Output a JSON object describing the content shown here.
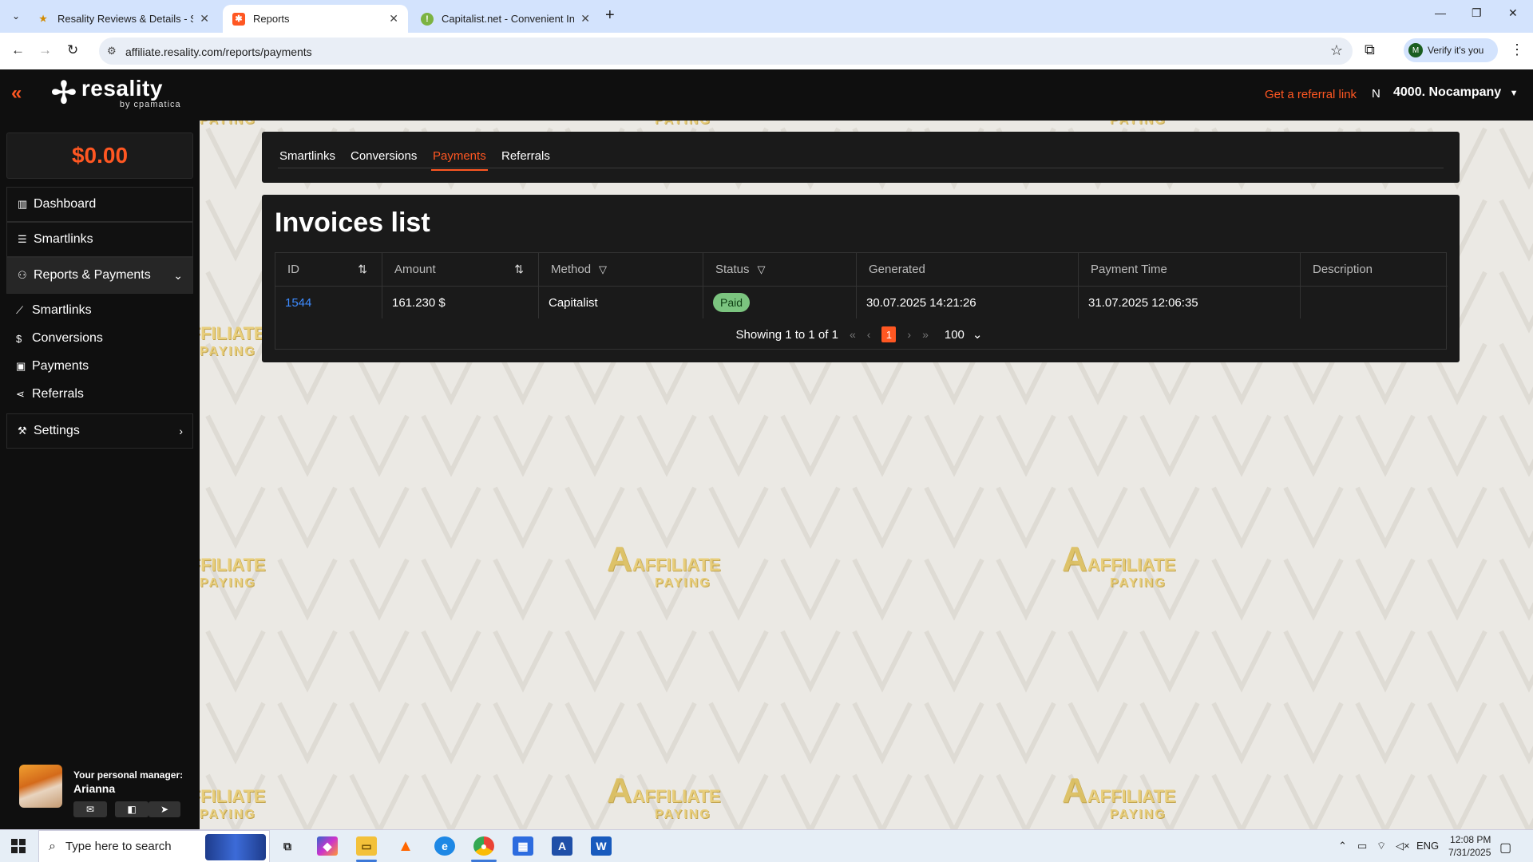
{
  "browser": {
    "tabs": [
      {
        "title": "Resality Reviews & Details - Sm",
        "active": false
      },
      {
        "title": "Reports",
        "active": true
      },
      {
        "title": "Capitalist.net - Convenient Inte",
        "active": false
      }
    ],
    "url": "affiliate.resality.com/reports/payments",
    "verify_label": "Verify it's you",
    "profile_initial": "M"
  },
  "header": {
    "logo_name": "resality",
    "logo_sub": "by cpamatica",
    "referral_link": "Get a referral link",
    "user_initial": "N",
    "account_name": "4000. Nocampany",
    "accent_color": "#ff5722"
  },
  "sidebar": {
    "balance": "$0.00",
    "items": [
      {
        "label": "Dashboard",
        "icon": "bar-chart-icon"
      },
      {
        "label": "Smartlinks",
        "icon": "list-icon"
      },
      {
        "label": "Reports & Payments",
        "icon": "users-icon",
        "expanded": true
      },
      {
        "label": "Settings",
        "icon": "wrench-icon"
      }
    ],
    "subitems": [
      {
        "label": "Smartlinks",
        "icon": "line-chart-icon"
      },
      {
        "label": "Conversions",
        "icon": "dollar-icon"
      },
      {
        "label": "Payments",
        "icon": "receipt-icon"
      },
      {
        "label": "Referrals",
        "icon": "share-icon"
      }
    ],
    "manager": {
      "label": "Your personal manager:",
      "name": "Arianna"
    }
  },
  "reports": {
    "tabs": [
      "Smartlinks",
      "Conversions",
      "Payments",
      "Referrals"
    ],
    "active_tab": "Payments"
  },
  "invoices": {
    "title": "Invoices list",
    "columns": [
      "ID",
      "Amount",
      "Method",
      "Status",
      "Generated",
      "Payment Time",
      "Description"
    ],
    "rows": [
      {
        "id": "1544",
        "amount": "161.230 $",
        "method": "Capitalist",
        "status": "Paid",
        "generated": "30.07.2025 14:21:26",
        "payment_time": "31.07.2025 12:06:35",
        "description": ""
      }
    ],
    "pagination": {
      "showing": "Showing 1 to 1 of 1",
      "current_page": "1",
      "page_size": "100"
    }
  },
  "watermark": {
    "line1": "AFFILIATE",
    "line2": "PAYING"
  },
  "taskbar": {
    "search_placeholder": "Type here to search",
    "language": "ENG",
    "time": "12:08 PM",
    "date": "7/31/2025"
  }
}
